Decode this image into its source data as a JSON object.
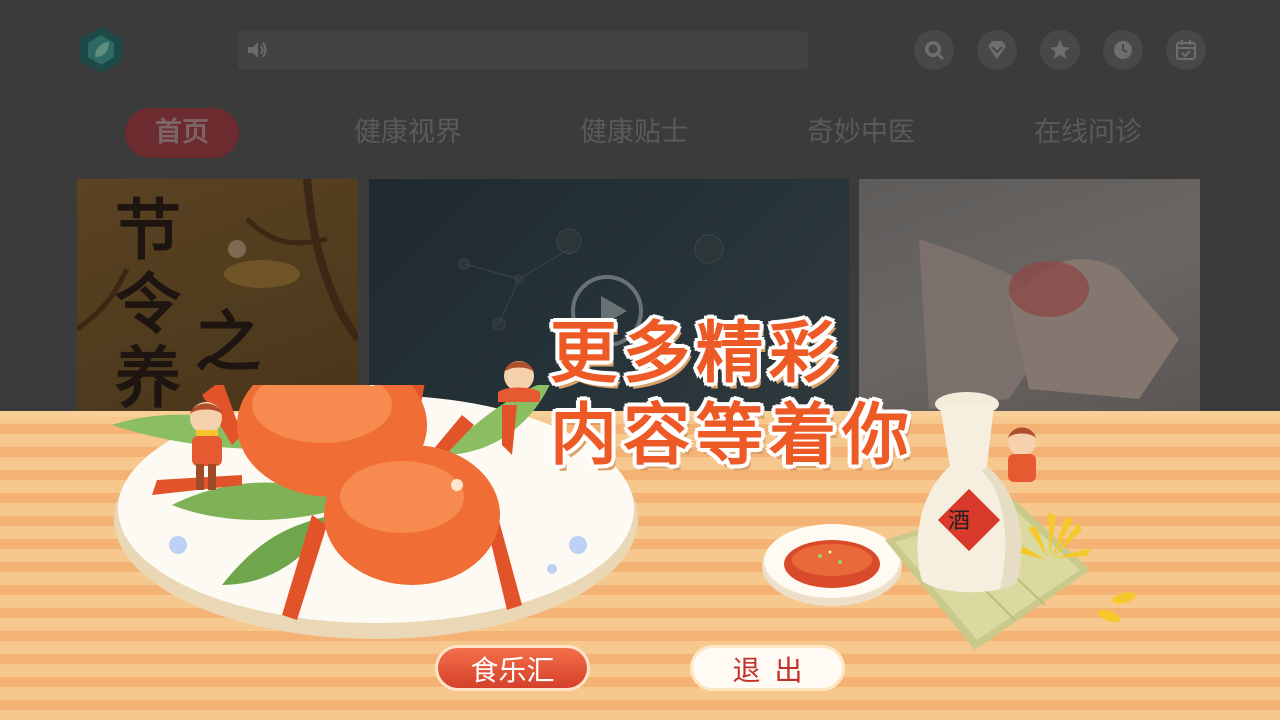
{
  "nav": {
    "tabs": [
      {
        "label": "首页",
        "active": true
      },
      {
        "label": "健康视界",
        "active": false
      },
      {
        "label": "健康贴士",
        "active": false
      },
      {
        "label": "奇妙中医",
        "active": false
      },
      {
        "label": "在线问诊",
        "active": false
      }
    ]
  },
  "header": {
    "icons": [
      "search-icon",
      "vip-diamond-icon",
      "favorites-star-icon",
      "history-clock-icon",
      "calendar-icon"
    ]
  },
  "cards": {
    "card1": {
      "calligraphy": "节令养",
      "calligraphy2": "之"
    }
  },
  "overlay": {
    "headline_line1": "更多精彩",
    "headline_line2": "内容等着你",
    "bottle_label": "酒",
    "food_button": "食乐汇",
    "exit_button": "退出"
  },
  "colors": {
    "accent": "#ee5a26",
    "button_red": "#d5402a",
    "table_light": "#f7c88d",
    "table_dark": "#f4b274",
    "dim_background": "#3b3b3b"
  }
}
